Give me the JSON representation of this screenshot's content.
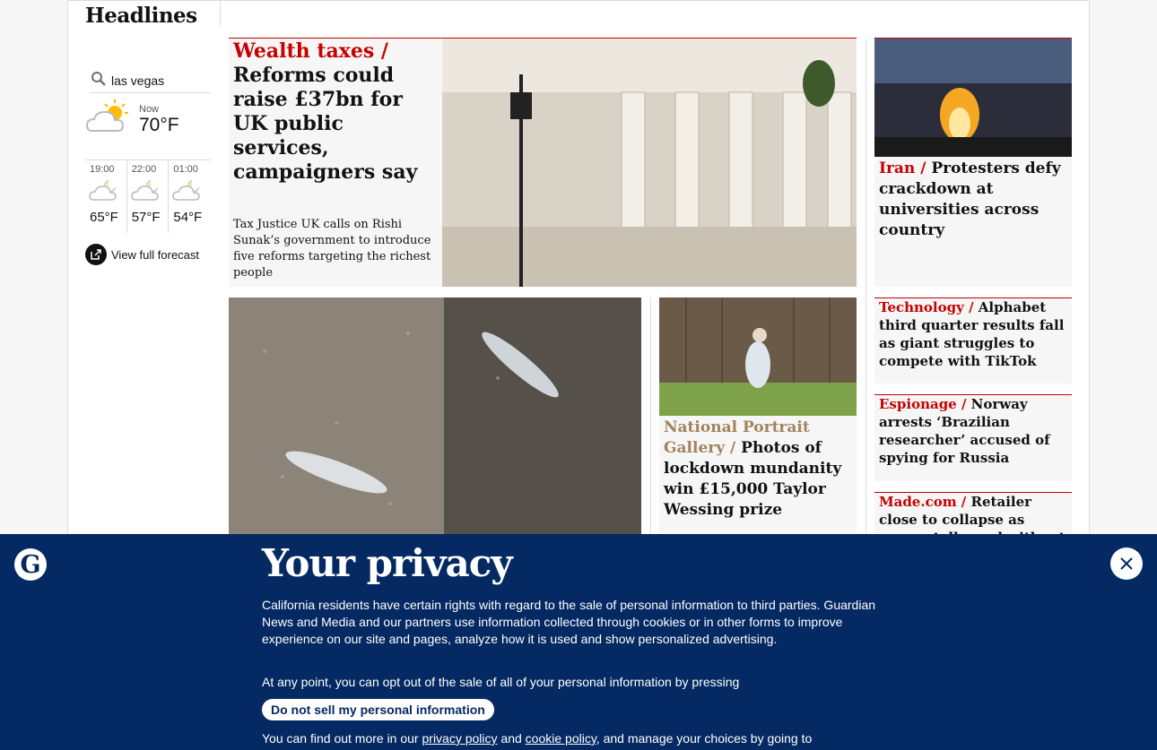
{
  "section_title": "Headlines",
  "weather": {
    "location": "las vegas",
    "now_label": "Now",
    "now_temp": "70°F",
    "hours": [
      {
        "time": "19:00",
        "temp": "65°F"
      },
      {
        "time": "22:00",
        "temp": "57°F"
      },
      {
        "time": "01:00",
        "temp": "54°F"
      }
    ],
    "forecast_link": "View full forecast"
  },
  "main_story": {
    "kicker": "Wealth taxes /",
    "headline": "Reforms could raise £37bn for UK public services, campaigners say",
    "standfirst": "Tax Justice UK calls on Rishi Sunak’s government to introduce five reforms targeting the richest people"
  },
  "iran_story": {
    "kicker": "Iran /",
    "headline": "Protesters defy crackdown at universities across country"
  },
  "npg_story": {
    "kicker": "National Portrait Gallery /",
    "headline": "Photos of lockdown mundanity win £15,000 Taylor Wessing prize"
  },
  "small_stories": [
    {
      "kicker": "Technology /",
      "headline": "Alphabet third quarter results fall as giant struggles to compete with TikTok"
    },
    {
      "kicker": "Espionage /",
      "headline": "Norway arrests ‘Brazilian researcher’ accused of spying for Russia"
    },
    {
      "kicker": "Made.com /",
      "headline": "Retailer close to collapse as rescue talks end without buyer"
    }
  ],
  "privacy": {
    "title": "Your privacy",
    "para1": "California residents have certain rights with regard to the sale of personal information to third parties. Guardian News and Media and our partners use information collected through cookies or in other forms to improve experience on our site and pages, analyze how it is used and show personalized advertising.",
    "para2": "At any point, you can opt out of the sale of all of your personal information by pressing",
    "button": "Do not sell my personal information",
    "para3_start": "You can find out more in our",
    "privacy_link": "privacy policy",
    "and": "and",
    "cookie_link": "cookie policy",
    "para3_end": ", and manage your choices by going to"
  },
  "colors": {
    "news_red": "#c70000",
    "culture_gold": "#a1845c",
    "brand_blue": "#052962"
  }
}
